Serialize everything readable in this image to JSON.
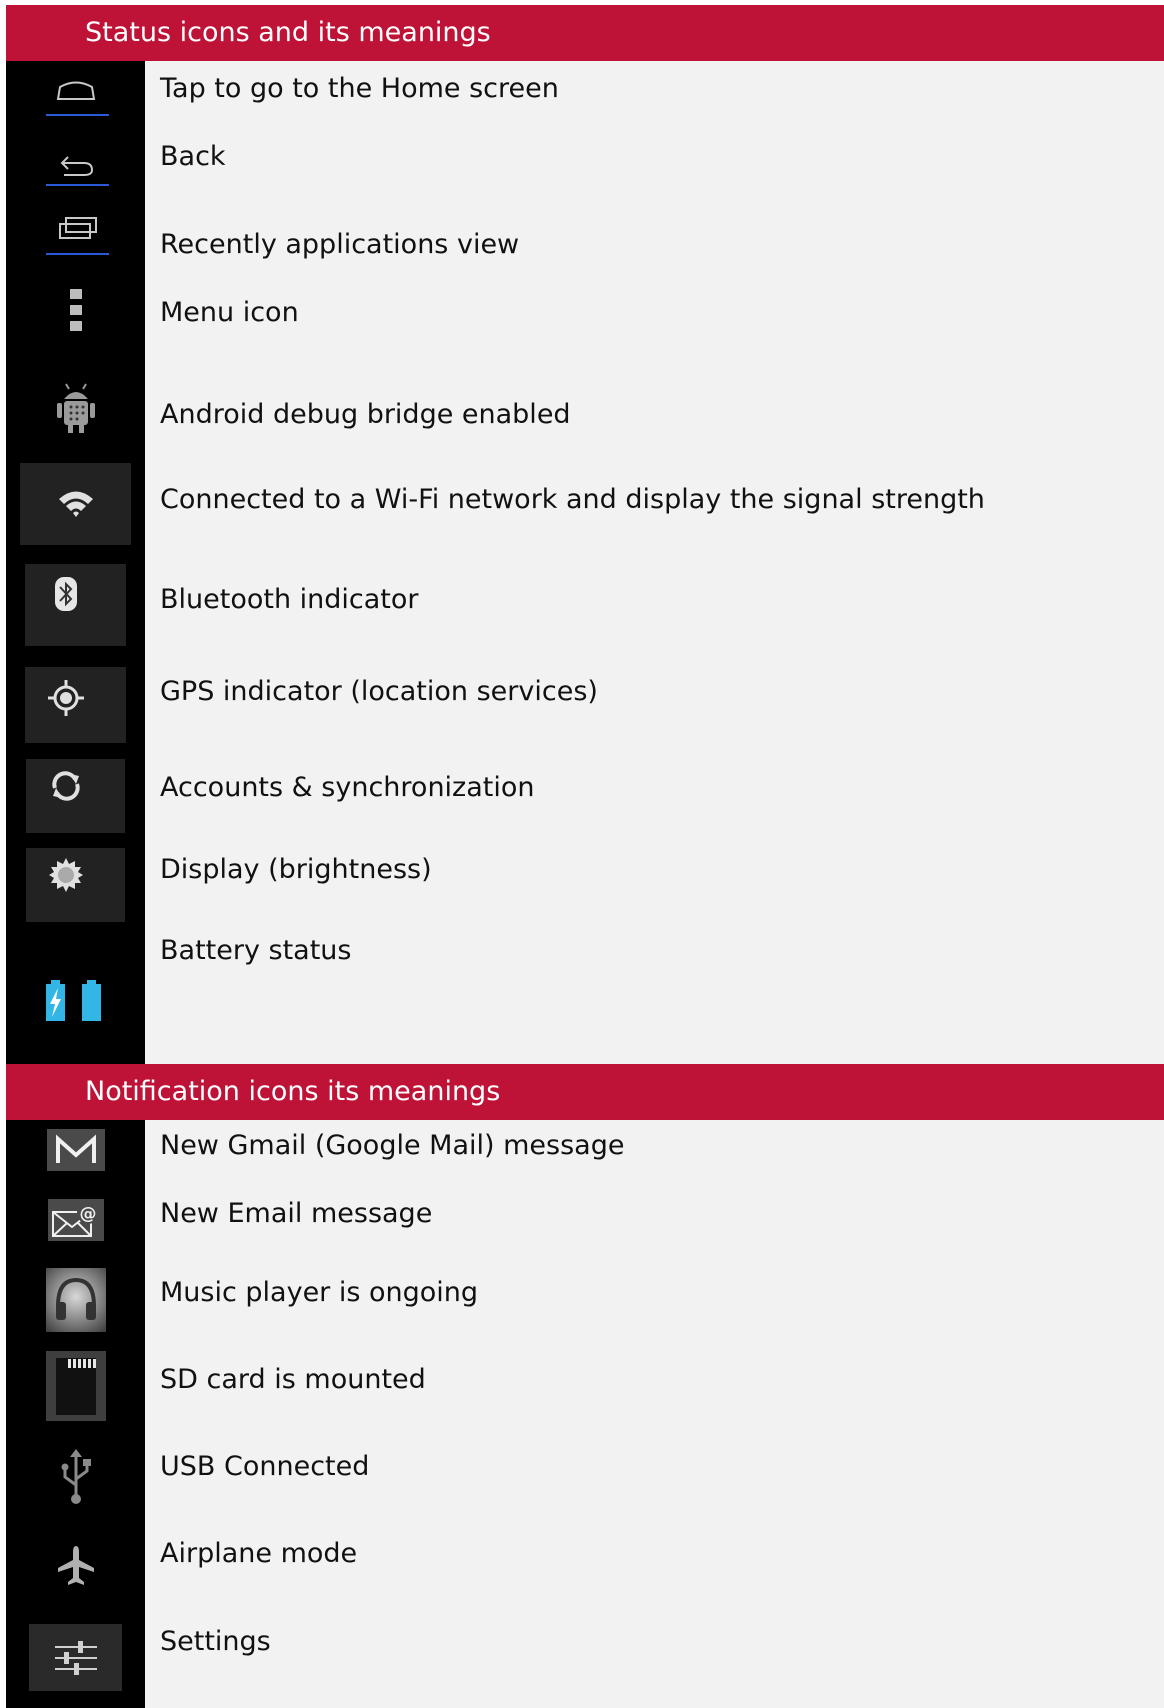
{
  "status_section": {
    "title": "Status icons and its meanings",
    "items": [
      {
        "icon": "home-icon",
        "label": "Tap to go to the Home screen"
      },
      {
        "icon": "back-icon",
        "label": "Back"
      },
      {
        "icon": "recent-apps-icon",
        "label": "Recently applications view"
      },
      {
        "icon": "menu-icon",
        "label": "Menu icon"
      },
      {
        "icon": "android-debug-icon",
        "label": "Android debug bridge enabled"
      },
      {
        "icon": "wifi-icon",
        "label": "Connected to a Wi-Fi network and display the signal strength"
      },
      {
        "icon": "bluetooth-icon",
        "label": "Bluetooth indicator"
      },
      {
        "icon": "gps-icon",
        "label": "GPS indicator (location services)"
      },
      {
        "icon": "sync-icon",
        "label": "Accounts & synchronization"
      },
      {
        "icon": "brightness-icon",
        "label": "Display (brightness)"
      },
      {
        "icon": "battery-icon",
        "label": "Battery status"
      }
    ]
  },
  "notification_section": {
    "title": "Notification icons its meanings",
    "items": [
      {
        "icon": "gmail-icon",
        "label": "New Gmail (Google Mail) message"
      },
      {
        "icon": "email-icon",
        "label": "New Email message"
      },
      {
        "icon": "music-icon",
        "label": "Music player is ongoing"
      },
      {
        "icon": "sd-card-icon",
        "label": "SD card is mounted"
      },
      {
        "icon": "usb-icon",
        "label": "USB Connected"
      },
      {
        "icon": "airplane-icon",
        "label": "Airplane mode"
      },
      {
        "icon": "settings-icon",
        "label": "Settings"
      }
    ]
  },
  "colors": {
    "header": "#be1237",
    "icon_column": "#000000",
    "page": "#f2f2f2",
    "battery": "#33b5e5",
    "nav_underline": "#2a5bd7"
  }
}
